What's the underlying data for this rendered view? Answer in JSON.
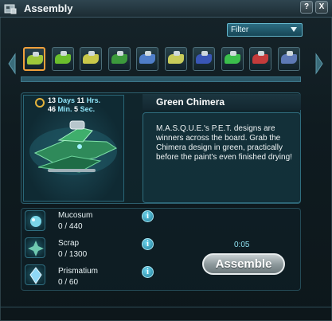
{
  "window": {
    "title": "Assembly",
    "help_label": "?",
    "close_label": "X"
  },
  "filter": {
    "label": "Filter"
  },
  "carousel": {
    "items": [
      {
        "name": "ship-1",
        "color": "#9ec83a",
        "active": true
      },
      {
        "name": "ship-2",
        "color": "#6bbf2d"
      },
      {
        "name": "ship-3",
        "color": "#c9c94a"
      },
      {
        "name": "ship-4",
        "color": "#3c9a3c"
      },
      {
        "name": "ship-5",
        "color": "#4f7ec9"
      },
      {
        "name": "ship-6",
        "color": "#c8cc5a"
      },
      {
        "name": "ship-7",
        "color": "#3956b6"
      },
      {
        "name": "ship-8",
        "color": "#3bbf4c"
      },
      {
        "name": "ship-9",
        "color": "#c43b3b"
      },
      {
        "name": "ship-10",
        "color": "#5d79b5"
      }
    ]
  },
  "detail": {
    "timer": {
      "days": "13",
      "days_label": "Days",
      "hours": "11",
      "hours_label": "Hrs.",
      "minutes": "46",
      "minutes_label": "Min.",
      "seconds": "5",
      "seconds_label": "Sec."
    },
    "name": "Green Chimera",
    "description": "M.A.S.Q.U.E.'s P.E.T. designs are winners across the board. Grab the Chimera design in green, practically before the paint's even finished drying!"
  },
  "requirements": [
    {
      "name": "Mucosum",
      "quantity": "0 / 440",
      "icon": "mucosum-icon"
    },
    {
      "name": "Scrap",
      "quantity": "0 / 1300",
      "icon": "scrap-icon"
    },
    {
      "name": "Prismatium",
      "quantity": "0 / 60",
      "icon": "prismatium-icon"
    }
  ],
  "assembly": {
    "time": "0:05",
    "button_label": "Assemble"
  },
  "colors": {
    "accent": "#63b6cc",
    "active_border": "#f1a03b",
    "timer_text": "#8fe3f7"
  }
}
